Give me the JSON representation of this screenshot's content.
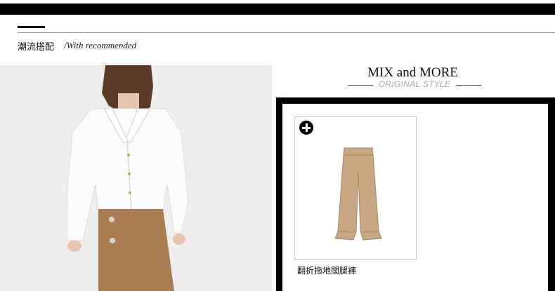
{
  "section": {
    "title": "潮流搭配",
    "subtitle": "/With recommended"
  },
  "mix": {
    "title": "MIX and MORE",
    "subtitle": "ORIGINAL STYLE"
  },
  "product": {
    "name": "翻折拖地闊腿褲",
    "add_icon": "plus-circle-icon",
    "color": "#c9a684"
  },
  "colors": {
    "bar": "#000000",
    "frame": "#000000",
    "subtitle_gray": "#aaaaaa"
  }
}
